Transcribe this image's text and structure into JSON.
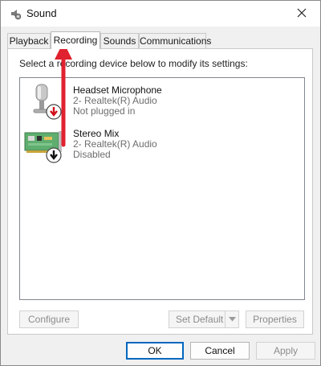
{
  "window": {
    "title": "Sound",
    "icon": "speaker-gear-icon",
    "close_icon": "close-icon"
  },
  "tabs": [
    {
      "label": "Playback",
      "active": false
    },
    {
      "label": "Recording",
      "active": true
    },
    {
      "label": "Sounds",
      "active": false
    },
    {
      "label": "Communications",
      "active": false
    }
  ],
  "panel": {
    "instruction": "Select a recording device below to modify its settings:",
    "devices": [
      {
        "name": "Headset Microphone",
        "driver": "2- Realtek(R) Audio",
        "status": "Not plugged in",
        "icon": "microphone-icon",
        "badge_icon": "red-down-arrow-badge-icon"
      },
      {
        "name": "Stereo Mix",
        "driver": "2- Realtek(R) Audio",
        "status": "Disabled",
        "icon": "sound-card-icon",
        "badge_icon": "black-down-arrow-badge-icon"
      }
    ],
    "buttons": {
      "configure": "Configure",
      "set_default": "Set Default",
      "properties": "Properties"
    }
  },
  "footer": {
    "ok": "OK",
    "cancel": "Cancel",
    "apply": "Apply"
  },
  "colors": {
    "annotation_arrow": "#e0212f",
    "accent": "#0067c0"
  }
}
